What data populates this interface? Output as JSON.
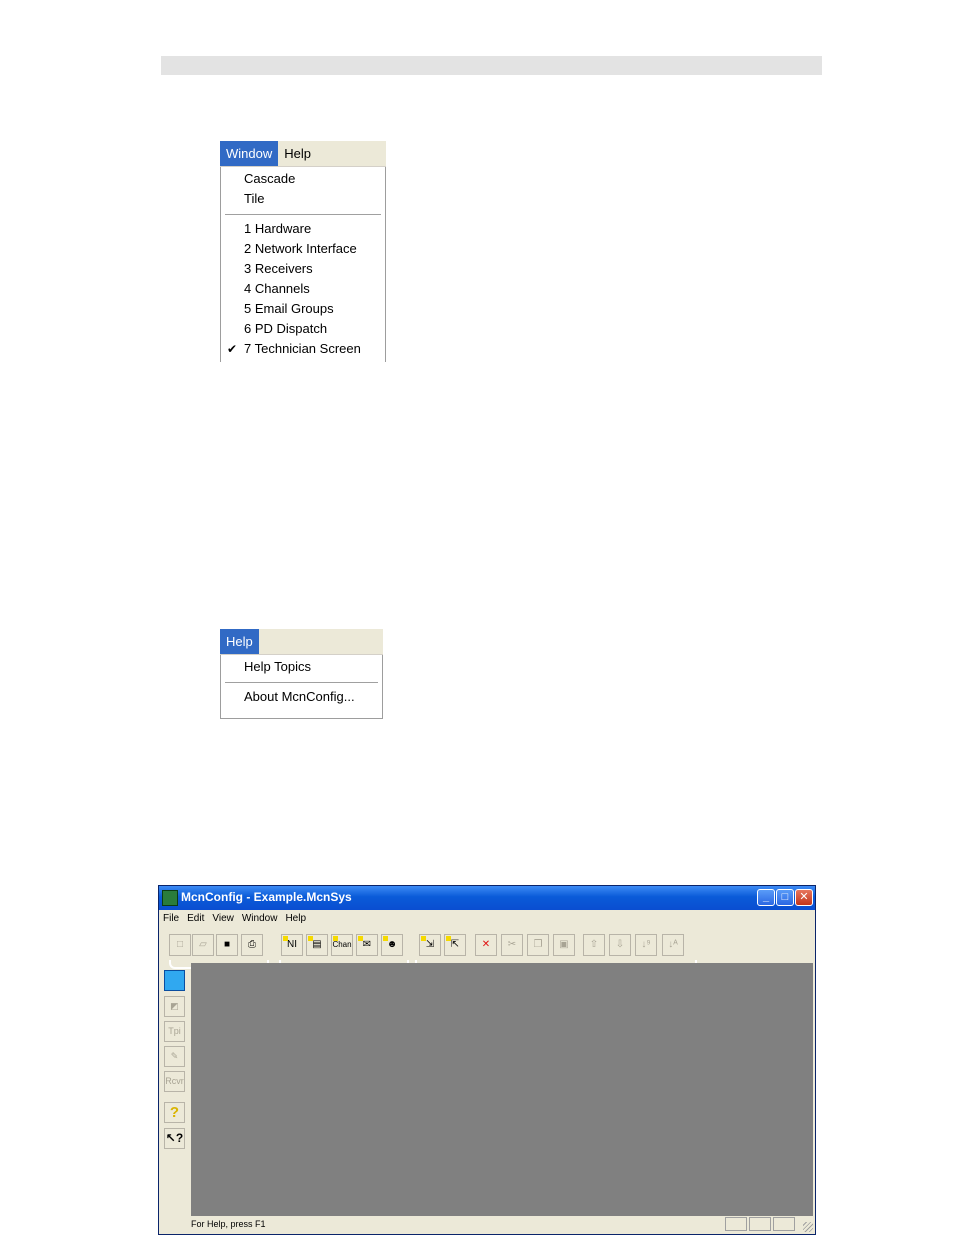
{
  "window_menu": {
    "menubar": [
      "Window",
      "Help"
    ],
    "items": [
      {
        "label": "Cascade",
        "checked": false
      },
      {
        "label": "Tile",
        "checked": false
      },
      {
        "separator": true
      },
      {
        "label": "1 Hardware",
        "checked": false
      },
      {
        "label": "2 Network Interface",
        "checked": false
      },
      {
        "label": "3 Receivers",
        "checked": false
      },
      {
        "label": "4 Channels",
        "checked": false
      },
      {
        "label": "5 Email Groups",
        "checked": false
      },
      {
        "label": "6 PD Dispatch",
        "checked": false
      },
      {
        "label": "7 Technician Screen",
        "checked": true
      }
    ]
  },
  "help_menu": {
    "menubar": [
      "Help"
    ],
    "items": [
      {
        "label": "Help Topics"
      },
      {
        "separator": true
      },
      {
        "label": "About McnConfig..."
      }
    ]
  },
  "app": {
    "title": "McnConfig - Example.McnSys",
    "menu": [
      "File",
      "Edit",
      "View",
      "Window",
      "Help"
    ],
    "toolbar": [
      {
        "name": "new-file-button",
        "icon": "new-file-icon",
        "glyph": "□",
        "enabled": false
      },
      {
        "name": "open-file-button",
        "icon": "open-folder-icon",
        "glyph": "▱",
        "enabled": false
      },
      {
        "name": "save-button",
        "icon": "save-disk-icon",
        "glyph": "■",
        "enabled": true
      },
      {
        "name": "print-button",
        "icon": "printer-icon",
        "glyph": "⎙",
        "enabled": true
      },
      {
        "name": "network-interface-button",
        "icon": "network-interface-icon",
        "glyph": "NI",
        "enabled": true
      },
      {
        "name": "receivers-button",
        "icon": "receiver-icon",
        "glyph": "▤",
        "enabled": true
      },
      {
        "name": "channels-button",
        "icon": "channel-icon",
        "glyph": "Chan",
        "enabled": true
      },
      {
        "name": "email-groups-button",
        "icon": "email-group-icon",
        "glyph": "✉",
        "enabled": true
      },
      {
        "name": "technician-button",
        "icon": "technician-icon",
        "glyph": "☻",
        "enabled": true
      },
      {
        "name": "insert-item-button",
        "icon": "insert-list-icon",
        "glyph": "⇲",
        "enabled": true
      },
      {
        "name": "append-item-button",
        "icon": "append-list-icon",
        "glyph": "⇱",
        "enabled": true
      },
      {
        "name": "delete-button",
        "icon": "delete-x-icon",
        "glyph": "✕",
        "enabled": true
      },
      {
        "name": "cut-button",
        "icon": "scissors-icon",
        "glyph": "✂",
        "enabled": false
      },
      {
        "name": "copy-button",
        "icon": "copy-icon",
        "glyph": "❐",
        "enabled": false
      },
      {
        "name": "paste-button",
        "icon": "paste-icon",
        "glyph": "▣",
        "enabled": false
      },
      {
        "name": "move-up-button",
        "icon": "arrow-up-icon",
        "glyph": "⇧",
        "enabled": false
      },
      {
        "name": "move-down-button",
        "icon": "arrow-down-icon",
        "glyph": "⇩",
        "enabled": false
      },
      {
        "name": "sort-numeric-button",
        "icon": "sort-numeric-icon",
        "glyph": "↓⁹",
        "enabled": false
      },
      {
        "name": "sort-alpha-button",
        "icon": "sort-alpha-icon",
        "glyph": "↓ᴬ",
        "enabled": false
      }
    ],
    "side_toolbar": [
      {
        "name": "new-window-button",
        "icon": "new-window-icon",
        "glyph": "",
        "enabled": true
      },
      {
        "name": "hardware-button",
        "icon": "hardware-icon",
        "glyph": "◩",
        "enabled": false
      },
      {
        "name": "tpi-button",
        "icon": "tpi-icon",
        "glyph": "Tpi",
        "enabled": false
      },
      {
        "name": "dispatch-button",
        "icon": "dispatch-icon",
        "glyph": "✎",
        "enabled": false
      },
      {
        "name": "receiver-config-button",
        "icon": "rcvr-icon",
        "glyph": "Rcvr",
        "enabled": false
      },
      {
        "name": "help-button",
        "icon": "help-question-icon",
        "glyph": "?",
        "enabled": true
      },
      {
        "name": "context-help-button",
        "icon": "context-help-icon",
        "glyph": "↖?",
        "enabled": true
      }
    ],
    "status": "For Help, press F1",
    "colors": {
      "titlebar": "#0a5bd8",
      "client_area": "#808080",
      "menu_highlight": "#316ac5"
    }
  }
}
